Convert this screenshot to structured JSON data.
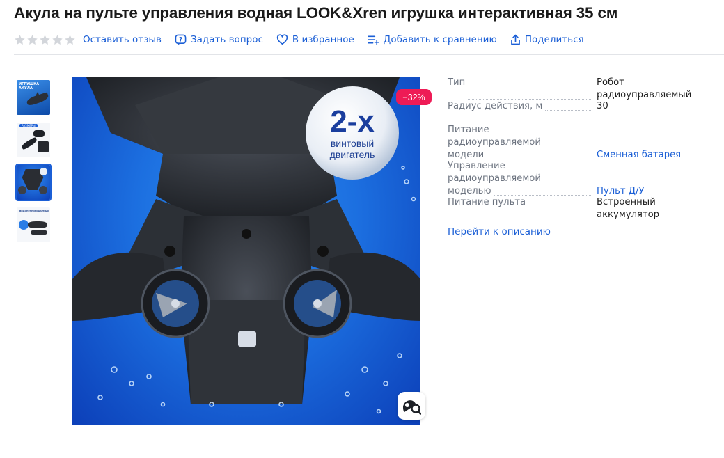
{
  "product": {
    "title": "Акула на пульте управления водная LOOK&Xren игрушка интерактивная 35 см"
  },
  "actions": {
    "rating_stars": 0,
    "review": "Оставить отзыв",
    "question": "Задать вопрос",
    "favorite": "В избранное",
    "compare": "Добавить к сравнению",
    "share": "Поделиться"
  },
  "gallery": {
    "thumb1_text": "ИГРУШКА АКУЛА",
    "thumb2_text": "РАЗМЕРЫ",
    "thumb4_text": "ВОДОНЕПРОНИЦАЕМЫЙ",
    "badge_big": "2-х",
    "badge_line1": "винтовый",
    "badge_line2": "двигатель",
    "discount": "−32%"
  },
  "specs": [
    {
      "key": "Тип",
      "value": "Робот радиоуправляемый",
      "link": false
    },
    {
      "key": "Радиус действия, м",
      "value": "30",
      "link": false
    },
    {
      "key": "Питание радиоуправляемой модели",
      "value": "Сменная батарея",
      "link": true
    },
    {
      "key": "Управление радиоуправляемой моделью",
      "value": "Пульт Д/У",
      "link": true
    },
    {
      "key": "Питание пульта",
      "value": "Встроенный аккумулятор",
      "link": false
    }
  ],
  "more_link": "Перейти к описанию",
  "colors": {
    "accent": "#1b5fd6",
    "discount": "#ee1b56",
    "star_empty": "#d3d6db"
  }
}
